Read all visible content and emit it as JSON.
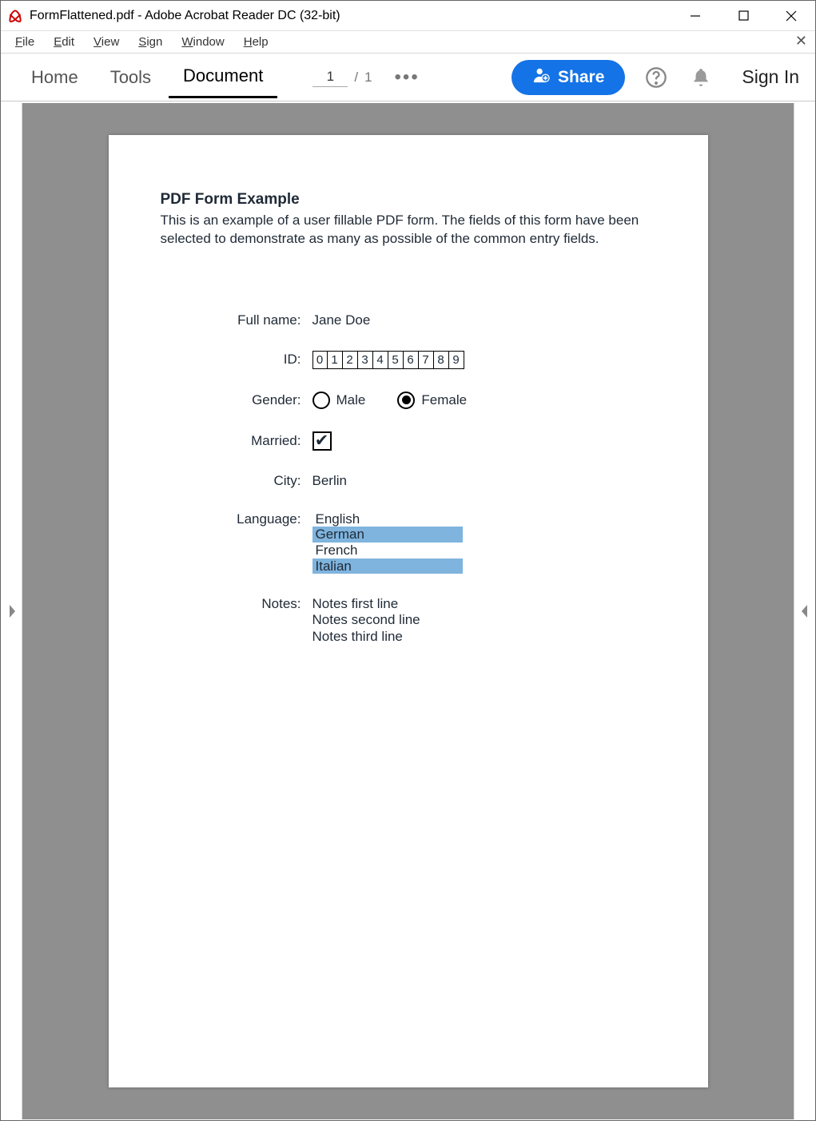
{
  "window": {
    "title": "FormFlattened.pdf - Adobe Acrobat Reader DC (32-bit)"
  },
  "menubar": {
    "file": "File",
    "edit": "Edit",
    "view": "View",
    "sign": "Sign",
    "window": "Window",
    "help": "Help"
  },
  "toolbar": {
    "home": "Home",
    "tools": "Tools",
    "document": "Document",
    "page_current": "1",
    "page_slash": "/",
    "page_total": "1",
    "share": "Share",
    "signin": "Sign In"
  },
  "doc": {
    "heading": "PDF Form Example",
    "intro": "This is an example of a user fillable PDF form. The fields of this form have been selected to demonstrate as many as possible of the common entry fields.",
    "labels": {
      "full_name": "Full name:",
      "id": "ID:",
      "gender": "Gender:",
      "married": "Married:",
      "city": "City:",
      "language": "Language:",
      "notes": "Notes:"
    },
    "values": {
      "full_name": "Jane Doe",
      "id_digits": [
        "0",
        "1",
        "2",
        "3",
        "4",
        "5",
        "6",
        "7",
        "8",
        "9"
      ],
      "gender_male": "Male",
      "gender_female": "Female",
      "gender_selected": "female",
      "married_checked": true,
      "city": "Berlin",
      "languages": [
        {
          "name": "English",
          "selected": false
        },
        {
          "name": "German",
          "selected": true
        },
        {
          "name": "French",
          "selected": false
        },
        {
          "name": "Italian",
          "selected": true
        }
      ],
      "notes": [
        "Notes first line",
        "Notes second line",
        "Notes third line"
      ]
    }
  }
}
